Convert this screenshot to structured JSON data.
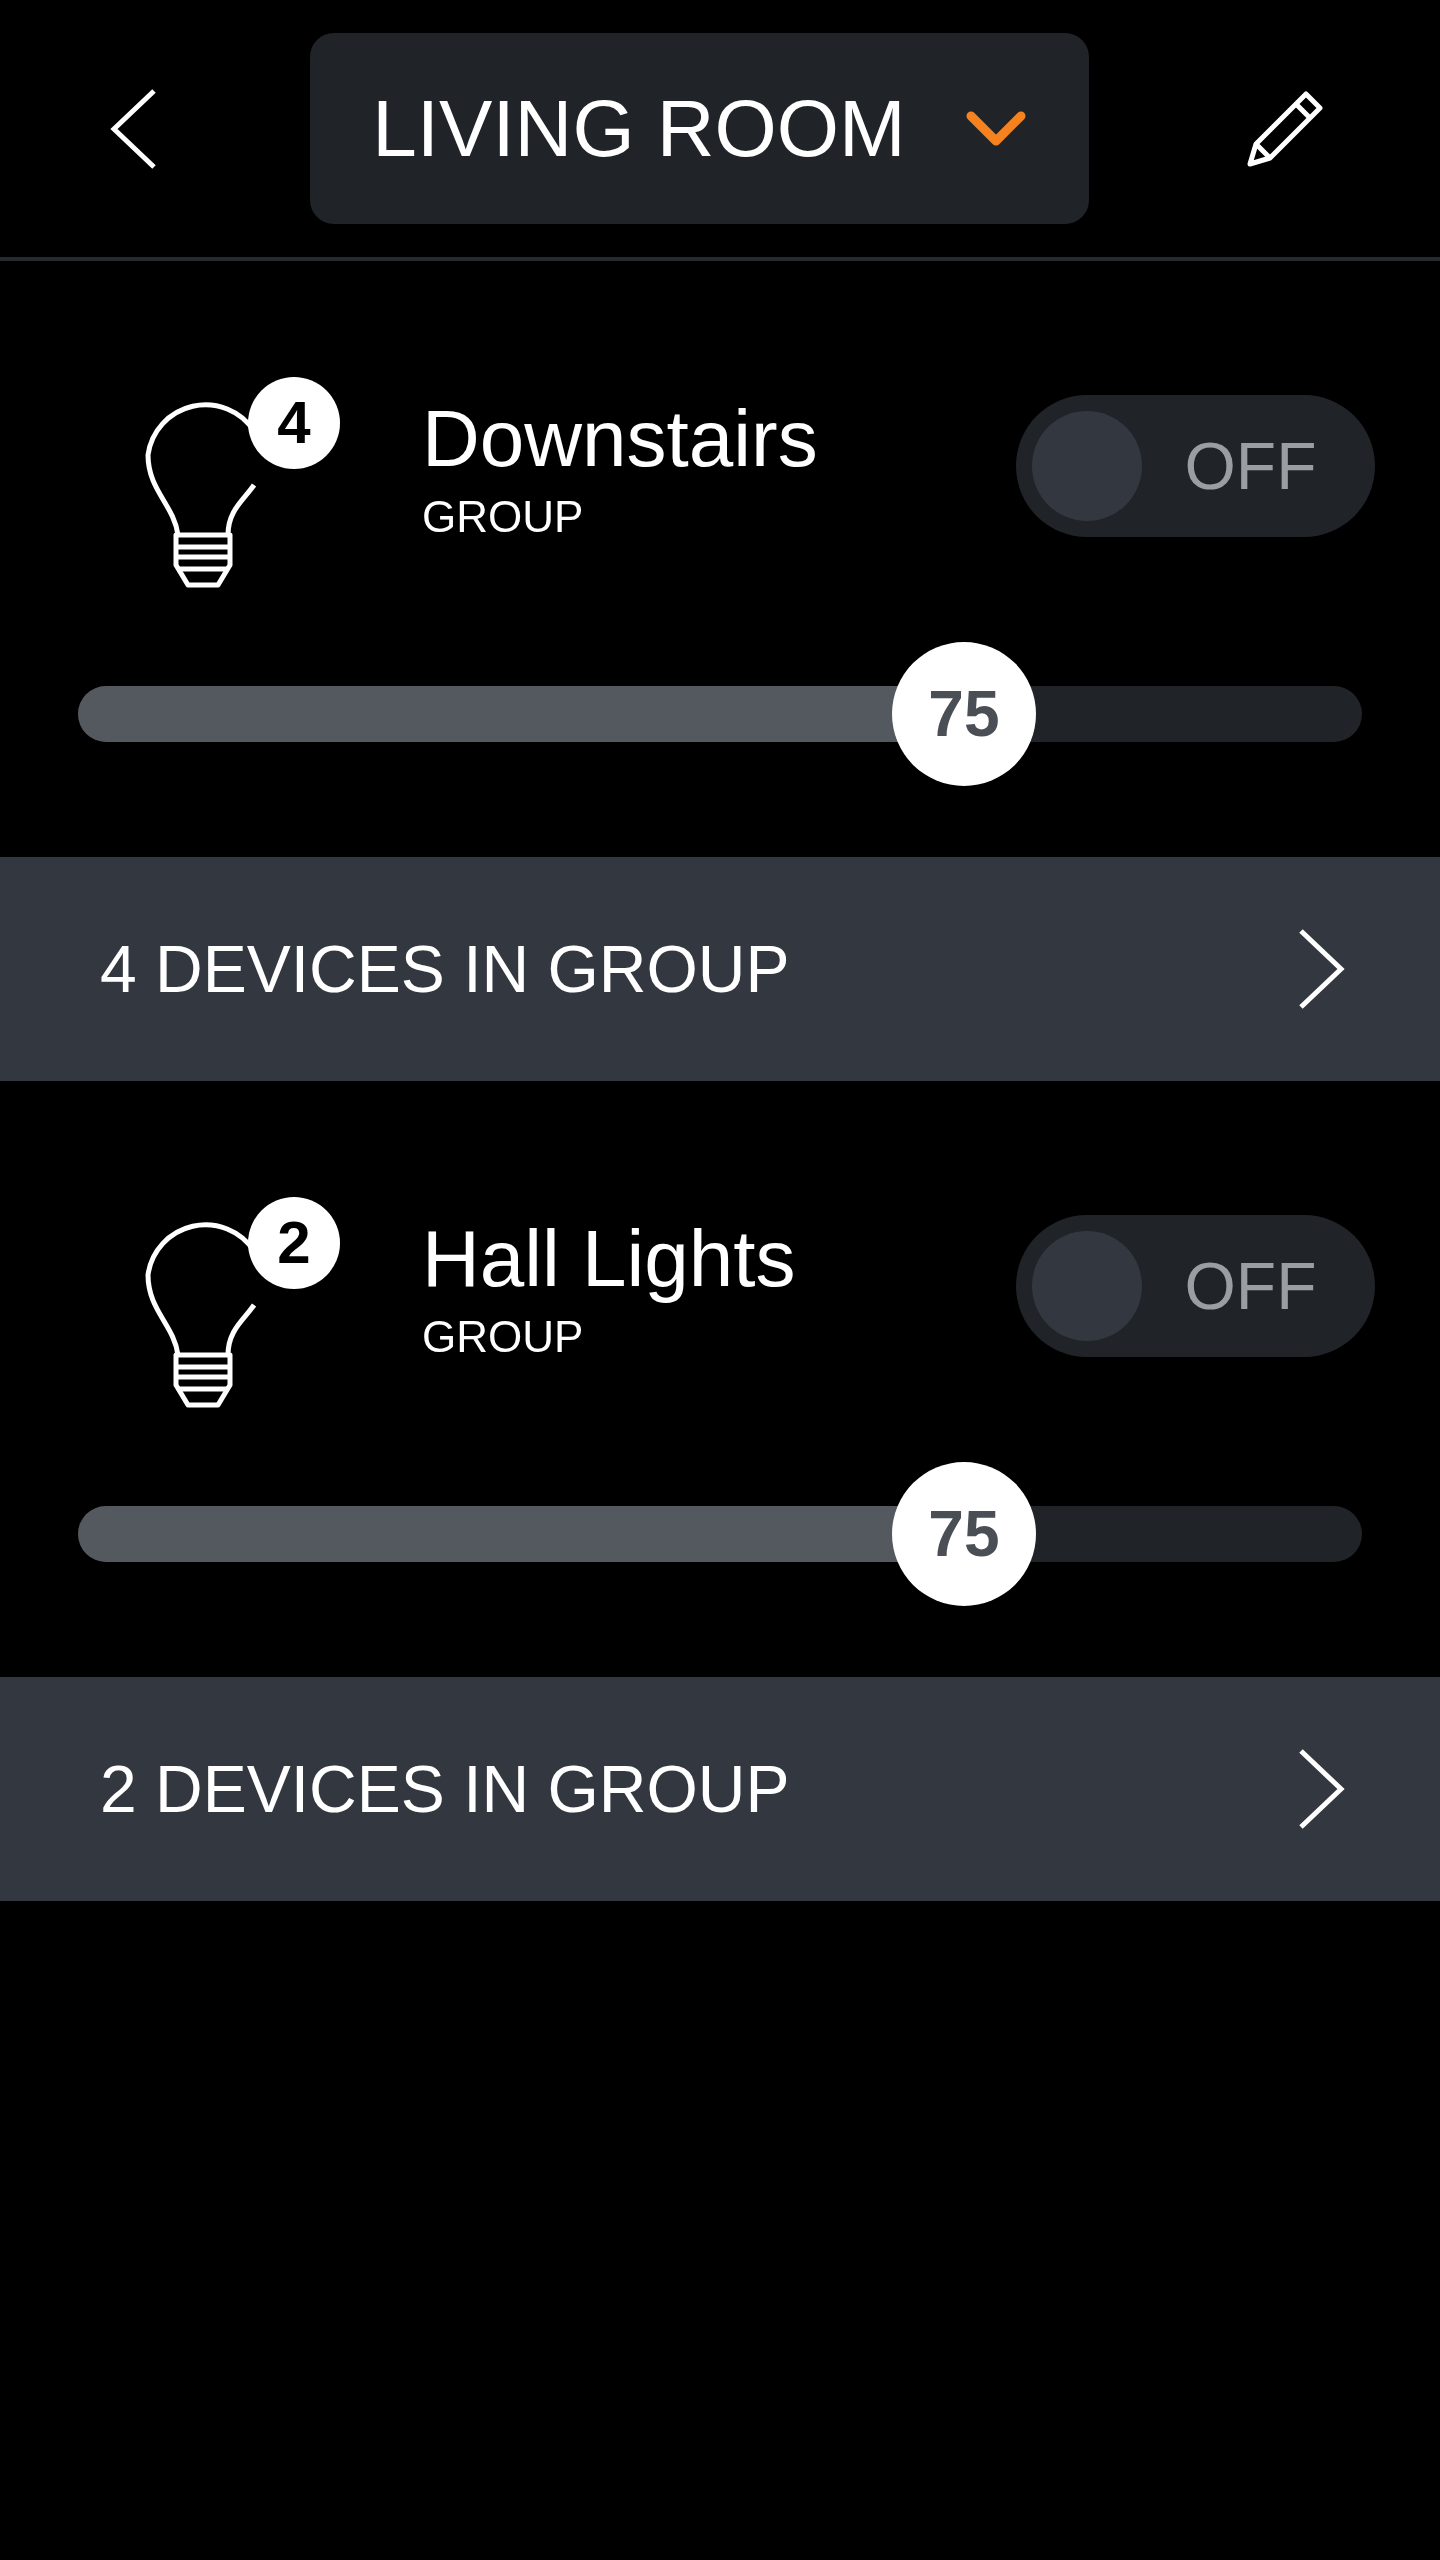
{
  "header": {
    "room": "LIVING ROOM"
  },
  "groups": [
    {
      "name": "Downstairs",
      "subtitle": "GROUP",
      "badge": "4",
      "on": false,
      "toggle_label": "OFF",
      "level": 0.69,
      "reading": "75",
      "devices_label": "4 DEVICES IN GROUP"
    },
    {
      "name": "Hall Lights",
      "subtitle": "GROUP",
      "badge": "2",
      "on": false,
      "toggle_label": "OFF",
      "level": 0.69,
      "reading": "75",
      "devices_label": "2 DEVICES IN GROUP"
    }
  ]
}
